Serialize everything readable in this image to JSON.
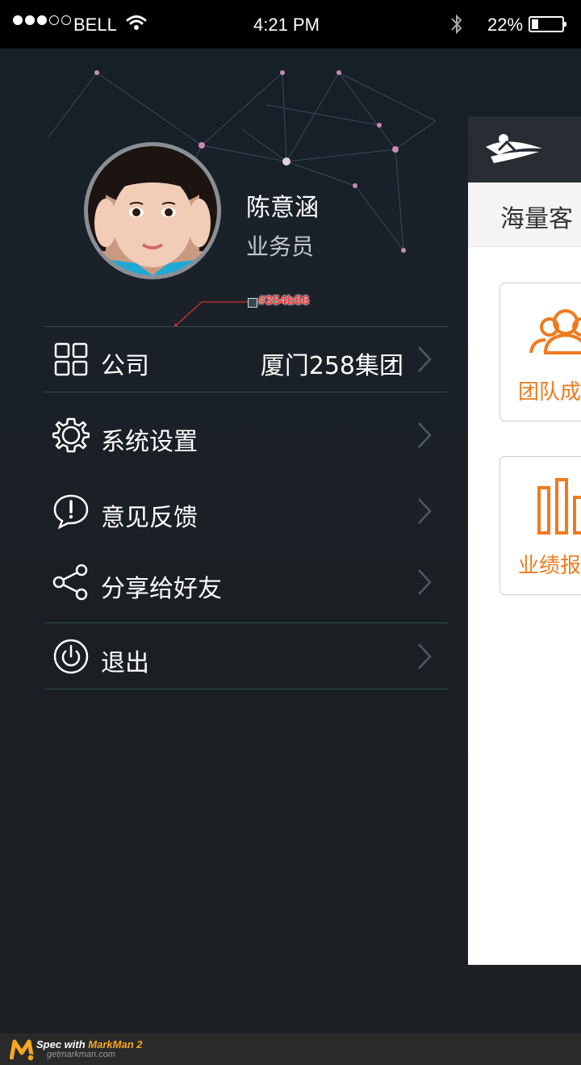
{
  "status_bar": {
    "carrier": "BELL",
    "time": "4:21 PM",
    "battery_percent": "22%",
    "battery_level": 0.22,
    "signal_bars_filled": 3,
    "signal_bars_total": 5
  },
  "profile": {
    "name": "陈意涵",
    "role": "业务员"
  },
  "annotation": {
    "color_label": "#354b56",
    "color": "#354b56"
  },
  "menu": {
    "items": [
      {
        "icon": "grid-icon",
        "label": "公司",
        "value": "厦门258集团"
      },
      {
        "icon": "gear-icon",
        "label": "系统设置"
      },
      {
        "icon": "feedback-icon",
        "label": "意见反馈"
      },
      {
        "icon": "share-icon",
        "label": "分享给好友"
      },
      {
        "icon": "power-icon",
        "label": "退出"
      }
    ]
  },
  "content_panel": {
    "subtitle": "海量客",
    "cards": [
      {
        "icon": "team-icon",
        "label": "团队成"
      },
      {
        "icon": "bar-chart-icon",
        "label": "业绩报"
      }
    ]
  },
  "footer": {
    "spec_prefix": "Spec with ",
    "brand": "MarkMan 2",
    "url": "getmarkman.com"
  },
  "colors": {
    "accent": "#f07a1e",
    "divider": "#354b56",
    "background": "#1c2024"
  }
}
